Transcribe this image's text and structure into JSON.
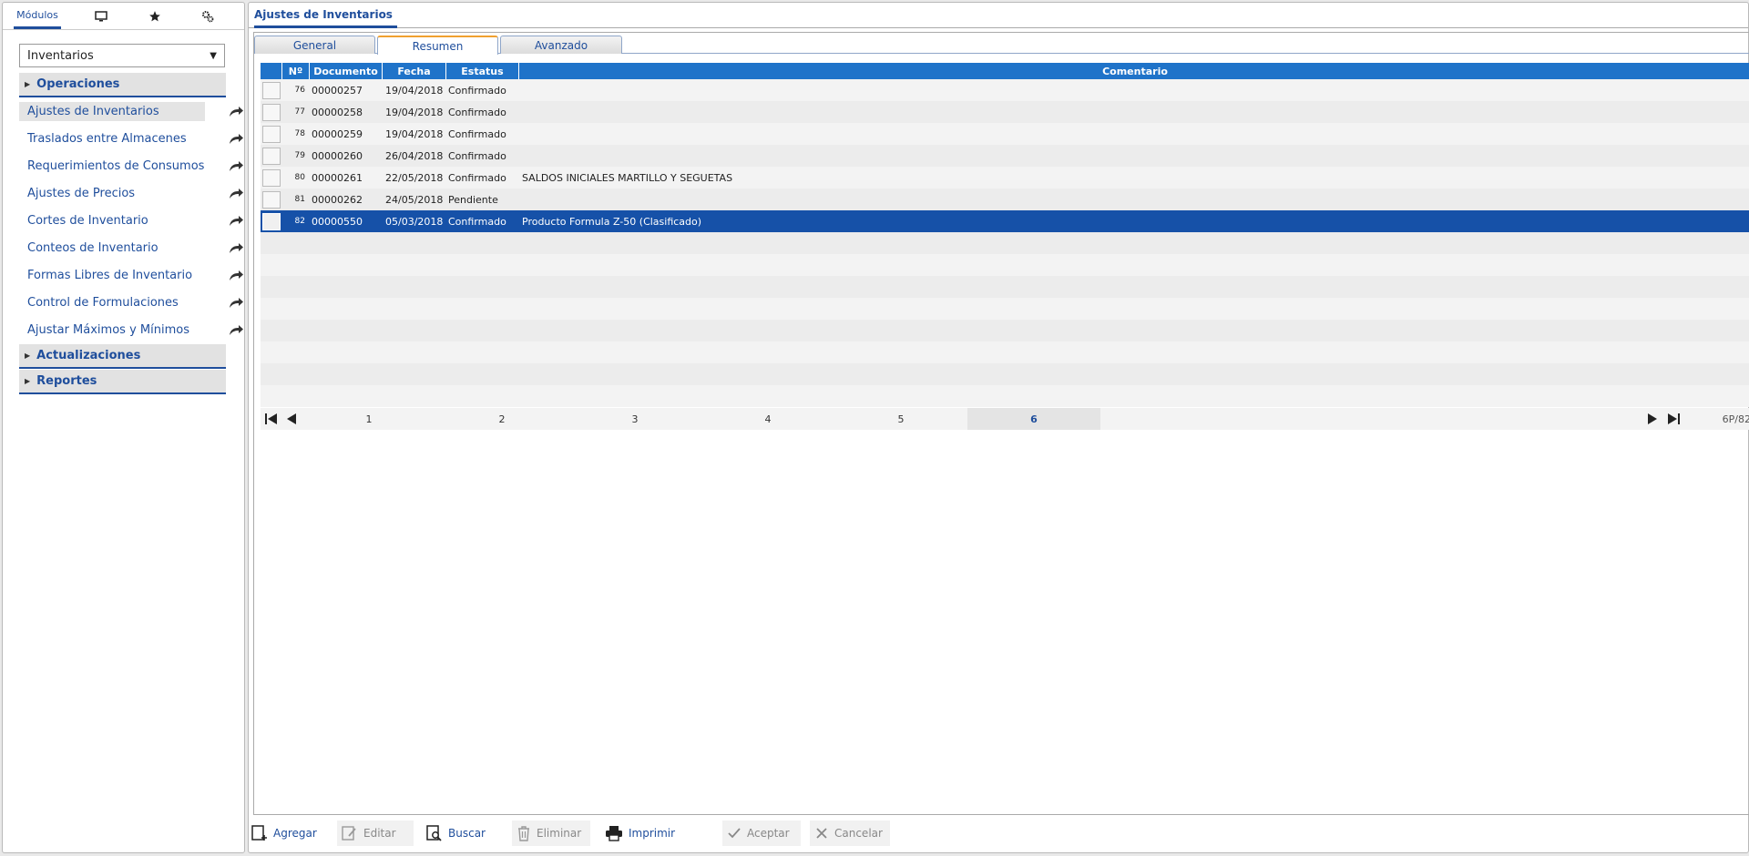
{
  "sidebar": {
    "tabs": [
      {
        "label": "Módulos",
        "icon": ""
      },
      {
        "label": "",
        "icon": "monitor-icon"
      },
      {
        "label": "",
        "icon": "star-icon"
      },
      {
        "label": "",
        "icon": "gears-icon"
      }
    ],
    "module_select": "Inventarios",
    "sections": {
      "operaciones": "Operaciones",
      "actualizaciones": "Actualizaciones",
      "reportes": "Reportes"
    },
    "items": [
      "Ajustes de Inventarios",
      "Traslados entre Almacenes",
      "Requerimientos de Consumos",
      "Ajustes de Precios",
      "Cortes de Inventario",
      "Conteos de Inventario",
      "Formas Libres de Inventario",
      "Control de Formulaciones",
      "Ajustar Máximos y Mínimos"
    ]
  },
  "main": {
    "title": "Ajustes de Inventarios",
    "tabs": [
      "General",
      "Resumen",
      "Avanzado"
    ],
    "active_tab": "Resumen"
  },
  "grid": {
    "headers": [
      "Nº",
      "Documento",
      "Fecha",
      "Estatus",
      "Comentario"
    ],
    "rows": [
      {
        "n": "76",
        "doc": "00000257",
        "fecha": "19/04/2018",
        "estatus": "Confirmado",
        "comentario": ""
      },
      {
        "n": "77",
        "doc": "00000258",
        "fecha": "19/04/2018",
        "estatus": "Confirmado",
        "comentario": ""
      },
      {
        "n": "78",
        "doc": "00000259",
        "fecha": "19/04/2018",
        "estatus": "Confirmado",
        "comentario": ""
      },
      {
        "n": "79",
        "doc": "00000260",
        "fecha": "26/04/2018",
        "estatus": "Confirmado",
        "comentario": ""
      },
      {
        "n": "80",
        "doc": "00000261",
        "fecha": "22/05/2018",
        "estatus": "Confirmado",
        "comentario": "SALDOS INICIALES MARTILLO Y SEGUETAS"
      },
      {
        "n": "81",
        "doc": "00000262",
        "fecha": "24/05/2018",
        "estatus": "Pendiente",
        "comentario": ""
      },
      {
        "n": "82",
        "doc": "00000550",
        "fecha": "05/03/2018",
        "estatus": "Confirmado",
        "comentario": "Producto Formula Z-50 (Clasificado)"
      }
    ],
    "selected_row": 6,
    "empty_rows": 8
  },
  "pager": {
    "pages": [
      "1",
      "2",
      "3",
      "4",
      "5",
      "6"
    ],
    "current": "6",
    "info": "6P/82"
  },
  "toolbar": {
    "agregar": "Agregar",
    "editar": "Editar",
    "buscar": "Buscar",
    "eliminar": "Eliminar",
    "imprimir": "Imprimir",
    "aceptar": "Aceptar",
    "cancelar": "Cancelar"
  },
  "colors": {
    "accent": "#1f4e9c",
    "header": "#1f73c9",
    "selected": "#1651a8",
    "tab_highlight": "#f0a030"
  }
}
